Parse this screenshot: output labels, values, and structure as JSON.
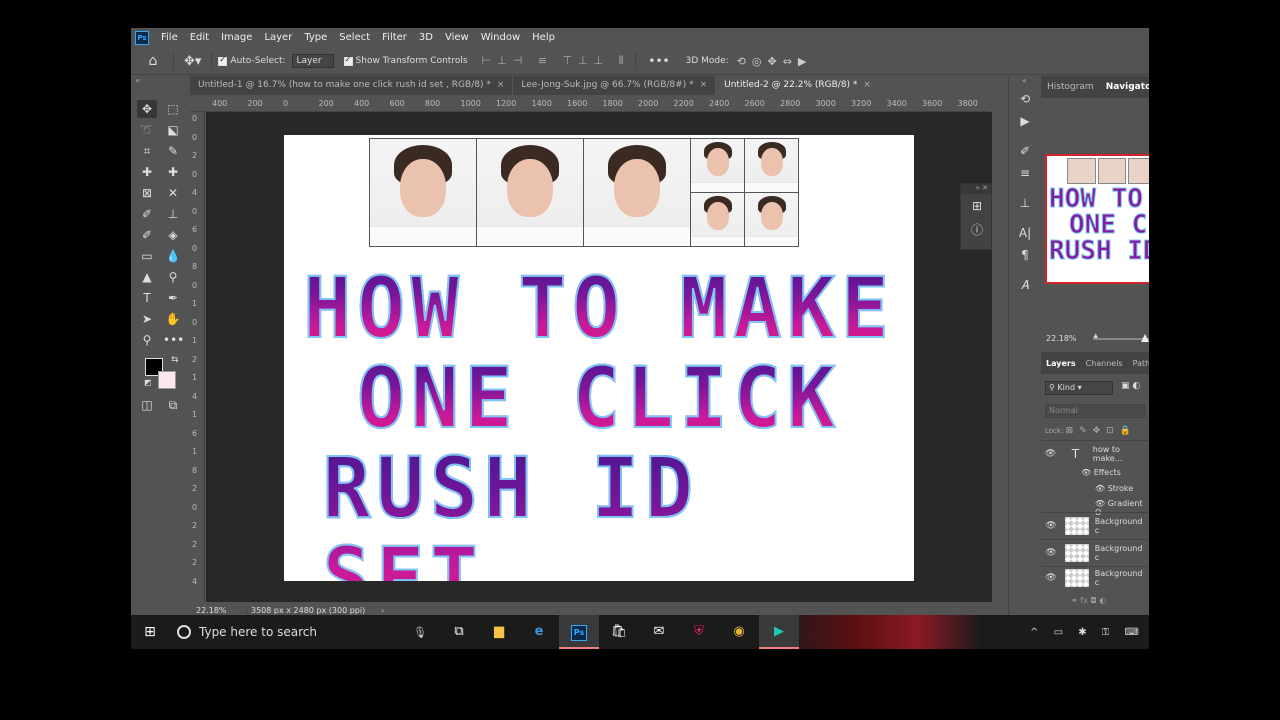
{
  "menu": {
    "items": [
      "File",
      "Edit",
      "Image",
      "Layer",
      "Type",
      "Select",
      "Filter",
      "3D",
      "View",
      "Window",
      "Help"
    ]
  },
  "options": {
    "auto_select_label": "Auto-Select:",
    "auto_select_target": "Layer",
    "show_transform_label": "Show Transform Controls",
    "mode_3d_label": "3D Mode:"
  },
  "tabs": [
    {
      "label": "Untitled-1 @ 16.7% (how to make one click rush id set , RGB/8) *",
      "active": false
    },
    {
      "label": "Lee-Jong-Suk.jpg @ 66.7% (RGB/8#) *",
      "active": false
    },
    {
      "label": "Untitled-2 @ 22.2% (RGB/8) *",
      "active": true
    }
  ],
  "ruler": {
    "top_labels": [
      "400",
      "200",
      "0",
      "200",
      "400",
      "600",
      "800",
      "1000",
      "1200",
      "1400",
      "1600",
      "1800",
      "2000",
      "2200",
      "2400",
      "2600",
      "2800",
      "3000",
      "3200",
      "3400",
      "3600",
      "3800"
    ],
    "left_labels": [
      "0",
      "0",
      "2",
      "0",
      "4",
      "0",
      "6",
      "0",
      "8",
      "0",
      "1",
      "0",
      "1",
      "2",
      "1",
      "4",
      "1",
      "6",
      "1",
      "8",
      "2",
      "0",
      "2",
      "2",
      "2",
      "4"
    ]
  },
  "canvas": {
    "headline_lines": [
      "HOW TO MAKE",
      "ONE CLICK",
      "RUSH ID SET"
    ]
  },
  "status": {
    "zoom": "22.18%",
    "doc_info": "3508 px x 2480 px (300 ppi)"
  },
  "navigator": {
    "tabs": [
      "Histogram",
      "Navigator"
    ],
    "active_tab": "Navigator",
    "preview_lines": [
      "HOW TO",
      "ONE C",
      "RUSH ID"
    ],
    "zoom": "22.18%"
  },
  "layers": {
    "tabs": [
      "Layers",
      "Channels",
      "Path"
    ],
    "filter_kind": "Kind",
    "blend_mode": "Normal",
    "lock_label": "Lock:",
    "items": [
      {
        "name": "how to make...",
        "type": "text"
      },
      {
        "name": "Background c",
        "type": "image"
      },
      {
        "name": "Background c",
        "type": "image"
      },
      {
        "name": "Background c",
        "type": "image"
      }
    ],
    "effects_label": "Effects",
    "effects": [
      "Stroke",
      "Gradient O"
    ]
  },
  "taskbar": {
    "search_placeholder": "Type here to search"
  },
  "colors": {
    "accent_blue": "#31a8ff",
    "headline_top": "#4a1790",
    "headline_bottom": "#e0167f",
    "headline_stroke": "#7ec7f5"
  }
}
